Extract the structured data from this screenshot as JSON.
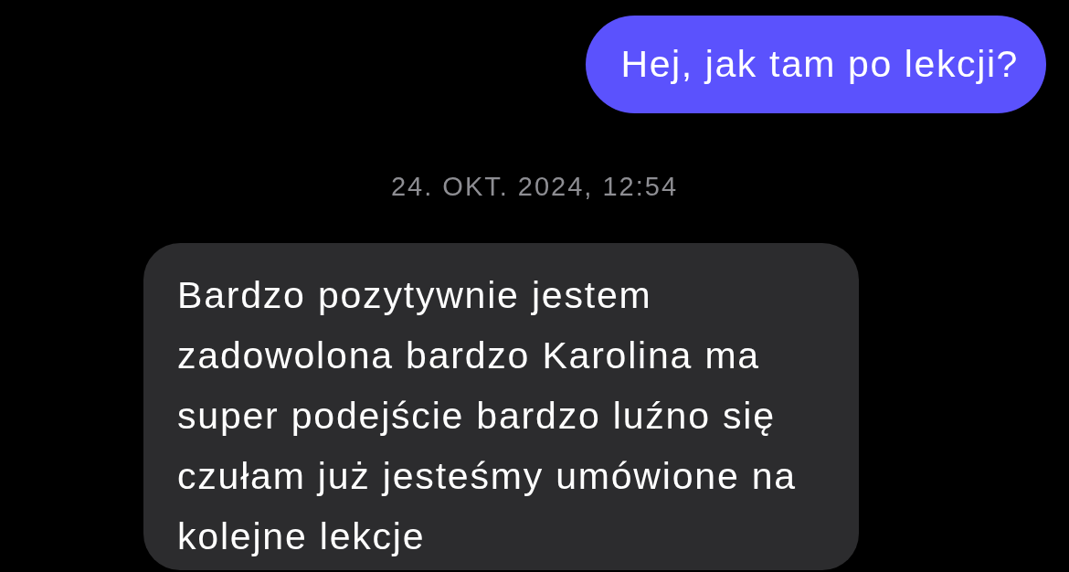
{
  "thread": [
    {
      "kind": "sent",
      "text": "Hej, jak tam po lekcji?"
    },
    {
      "kind": "time",
      "text": "24. OKT. 2024, 12:54"
    },
    {
      "kind": "received",
      "text": "Bardzo pozytywnie jestem zadowolona bardzo Karolina ma super podejście bardzo luźno się czułam już jesteśmy umówione na kolejne lekcje"
    }
  ]
}
